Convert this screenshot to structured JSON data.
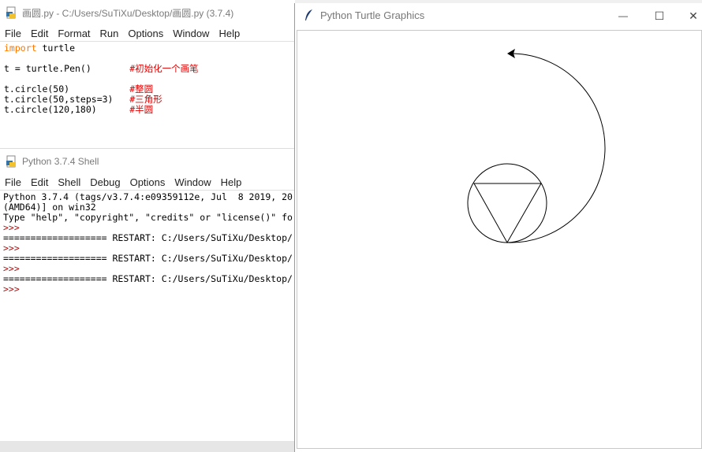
{
  "editor": {
    "title": "画圆.py - C:/Users/SuTiXu/Desktop/画圆.py (3.7.4)",
    "menu": [
      "File",
      "Edit",
      "Format",
      "Run",
      "Options",
      "Window",
      "Help"
    ],
    "lines": [
      {
        "code": "import turtle",
        "keyword": "import",
        "rest": " turtle",
        "comment": ""
      },
      {
        "code": "",
        "keyword": "",
        "rest": "",
        "comment": ""
      },
      {
        "code": "t = turtle.Pen()       ",
        "keyword": "",
        "rest": "t = turtle.Pen()       ",
        "comment": "#初始化一个画笔"
      },
      {
        "code": "",
        "keyword": "",
        "rest": "",
        "comment": ""
      },
      {
        "code": "t.circle(50)           ",
        "keyword": "",
        "rest": "t.circle(50)           ",
        "comment": "#整圆"
      },
      {
        "code": "t.circle(50,steps=3)   ",
        "keyword": "",
        "rest": "t.circle(50,steps=3)   ",
        "comment": "#三角形"
      },
      {
        "code": "t.circle(120,180)      ",
        "keyword": "",
        "rest": "t.circle(120,180)      ",
        "comment": "#半圆"
      }
    ]
  },
  "shell": {
    "title": "Python 3.7.4 Shell",
    "menu": [
      "File",
      "Edit",
      "Shell",
      "Debug",
      "Options",
      "Window",
      "Help"
    ],
    "lines": [
      {
        "type": "out",
        "text": "Python 3.7.4 (tags/v3.7.4:e09359112e, Jul  8 2019, 20"
      },
      {
        "type": "out",
        "text": "(AMD64)] on win32"
      },
      {
        "type": "out",
        "text": "Type \"help\", \"copyright\", \"credits\" or \"license()\" fo"
      },
      {
        "type": "prompt",
        "text": ">>>"
      },
      {
        "type": "out",
        "text": "=================== RESTART: C:/Users/SuTiXu/Desktop/"
      },
      {
        "type": "prompt",
        "text": ">>>"
      },
      {
        "type": "out",
        "text": "=================== RESTART: C:/Users/SuTiXu/Desktop/"
      },
      {
        "type": "prompt",
        "text": ">>>"
      },
      {
        "type": "out",
        "text": "=================== RESTART: C:/Users/SuTiXu/Desktop/"
      },
      {
        "type": "prompt",
        "text": ">>>"
      }
    ]
  },
  "turtle": {
    "title": "Python Turtle Graphics",
    "controls": {
      "minimize": "—",
      "maximize": "☐",
      "close": "✕"
    }
  },
  "icons": {
    "editor": "python-file-icon",
    "shell": "python-shell-icon",
    "turtle": "feather-icon"
  }
}
